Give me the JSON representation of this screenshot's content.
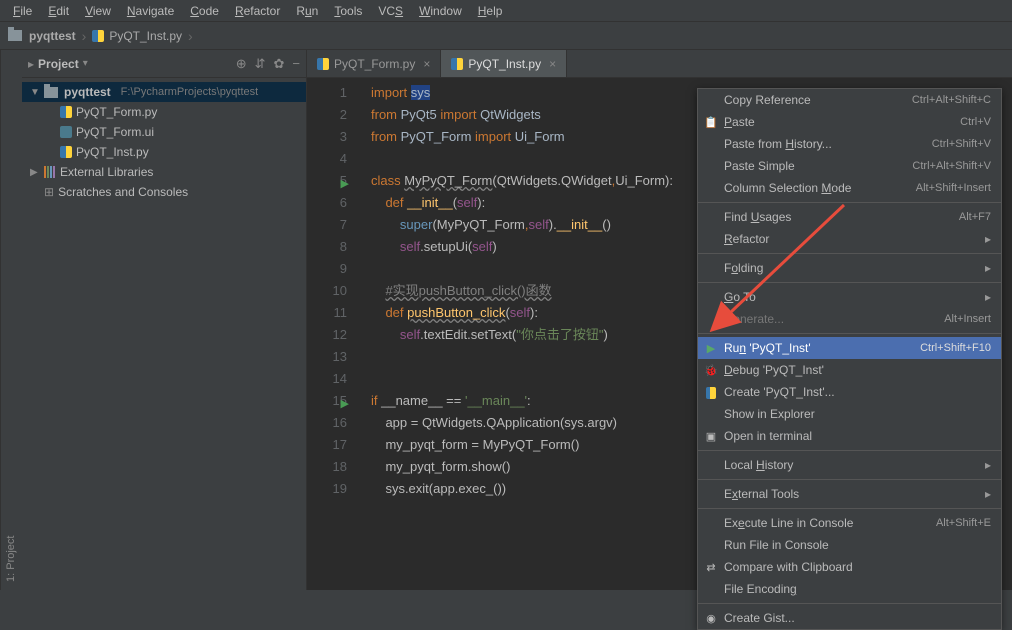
{
  "menu": [
    "File",
    "Edit",
    "View",
    "Navigate",
    "Code",
    "Refactor",
    "Run",
    "Tools",
    "VCS",
    "Window",
    "Help"
  ],
  "menu_ul": [
    "F",
    "E",
    "V",
    "N",
    "C",
    "R",
    "u",
    "T",
    "S",
    "W",
    "H"
  ],
  "breadcrumb": {
    "project": "pyqttest",
    "file": "PyQT_Inst.py"
  },
  "project_panel": {
    "title": "Project",
    "root": "pyqttest",
    "root_path": "F:\\PycharmProjects\\pyqttest",
    "files": [
      "PyQT_Form.py",
      "PyQT_Form.ui",
      "PyQT_Inst.py"
    ],
    "ext_lib": "External Libraries",
    "scratches": "Scratches and Consoles"
  },
  "tabs": [
    {
      "label": "PyQT_Form.py",
      "active": false
    },
    {
      "label": "PyQT_Inst.py",
      "active": true
    }
  ],
  "left_gutter": "1: Project",
  "code_lines": [
    1,
    2,
    3,
    4,
    5,
    6,
    7,
    8,
    9,
    10,
    11,
    12,
    13,
    14,
    15,
    16,
    17,
    18,
    19
  ],
  "ctx": {
    "copy_ref": "Copy Reference",
    "copy_ref_sc": "Ctrl+Alt+Shift+C",
    "paste": "Paste",
    "paste_sc": "Ctrl+V",
    "paste_hist": "Paste from History...",
    "paste_hist_sc": "Ctrl+Shift+V",
    "paste_simple": "Paste Simple",
    "paste_simple_sc": "Ctrl+Alt+Shift+V",
    "col_mode": "Column Selection Mode",
    "col_mode_sc": "Alt+Shift+Insert",
    "find_usages": "Find Usages",
    "find_usages_sc": "Alt+F7",
    "refactor": "Refactor",
    "folding": "Folding",
    "goto": "Go To",
    "generate": "Generate...",
    "generate_sc": "Alt+Insert",
    "run": "Run 'PyQT_Inst'",
    "run_sc": "Ctrl+Shift+F10",
    "debug": "Debug 'PyQT_Inst'",
    "create": "Create 'PyQT_Inst'...",
    "explorer": "Show in Explorer",
    "terminal": "Open in terminal",
    "local_hist": "Local History",
    "ext_tools": "External Tools",
    "exec_line": "Execute Line in Console",
    "exec_line_sc": "Alt+Shift+E",
    "run_file": "Run File in Console",
    "compare": "Compare with Clipboard",
    "encoding": "File Encoding",
    "gist": "Create Gist..."
  }
}
